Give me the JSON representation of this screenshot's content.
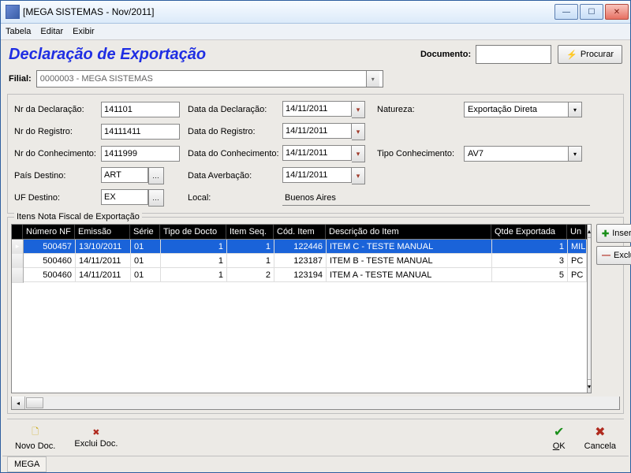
{
  "window": {
    "title": "[MEGA SISTEMAS - Nov/2011]"
  },
  "menu": {
    "tabela": "Tabela",
    "editar": "Editar",
    "exibir": "Exibir"
  },
  "header": {
    "title": "Declaração de Exportação",
    "documento_label": "Documento:",
    "documento_value": "",
    "procurar": "Procurar"
  },
  "filial": {
    "label": "Filial:",
    "value": "0000003 - MEGA SISTEMAS"
  },
  "form": {
    "nr_declaracao_label": "Nr da Declaração:",
    "nr_declaracao": "141101",
    "nr_registro_label": "Nr do Registro:",
    "nr_registro": "14111411",
    "nr_conhecimento_label": "Nr do Conhecimento:",
    "nr_conhecimento": "1411999",
    "pais_destino_label": "País Destino:",
    "pais_destino": "ART",
    "uf_destino_label": "UF Destino:",
    "uf_destino": "EX",
    "data_declaracao_label": "Data da Declaração:",
    "data_declaracao": "14/11/2011",
    "data_registro_label": "Data do Registro:",
    "data_registro": "14/11/2011",
    "data_conhecimento_label": "Data do Conhecimento:",
    "data_conhecimento": "14/11/2011",
    "data_averbacao_label": "Data Averbação:",
    "data_averbacao": "14/11/2011",
    "local_label": "Local:",
    "local": "Buenos Aires",
    "natureza_label": "Natureza:",
    "natureza": "Exportação Direta",
    "tipo_conhecimento_label": "Tipo Conhecimento:",
    "tipo_conhecimento": "AV7"
  },
  "grid": {
    "title": "Itens Nota Fiscal de Exportação",
    "columns": {
      "numero_nf": "Número NF",
      "emissao": "Emissão",
      "serie": "Série",
      "tipo_docto": "Tipo de Docto",
      "item_seq": "Item Seq.",
      "cod_item": "Cód. Item",
      "descricao": "Descrição do Item",
      "qtde_exp": "Qtde Exportada",
      "un": "Un"
    },
    "rows": [
      {
        "nf": "500457",
        "em": "13/10/2011",
        "se": "01",
        "td": "1",
        "is": "1",
        "ci": "122446",
        "de": "ITEM C - TESTE MANUAL",
        "qe": "1",
        "un": "MIL"
      },
      {
        "nf": "500460",
        "em": "14/11/2011",
        "se": "01",
        "td": "1",
        "is": "1",
        "ci": "123187",
        "de": "ITEM B - TESTE MANUAL",
        "qe": "3",
        "un": "PC"
      },
      {
        "nf": "500460",
        "em": "14/11/2011",
        "se": "01",
        "td": "1",
        "is": "2",
        "ci": "123194",
        "de": "ITEM A - TESTE MANUAL",
        "qe": "5",
        "un": "PC"
      }
    ]
  },
  "side": {
    "inserir": "Inserir",
    "excluir": "Excluir"
  },
  "footer": {
    "novo_doc": "Novo Doc.",
    "exclui_doc": "Exclui Doc.",
    "ok": "OK",
    "cancela": "Cancela"
  },
  "status": {
    "text": "MEGA"
  }
}
